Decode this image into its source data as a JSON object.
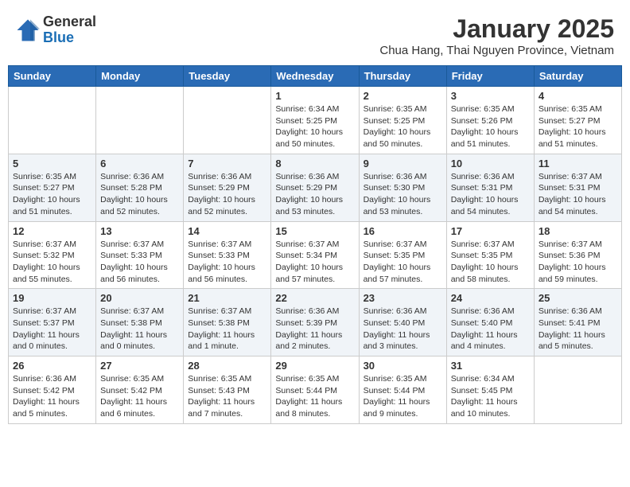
{
  "logo": {
    "general": "General",
    "blue": "Blue"
  },
  "title": "January 2025",
  "location": "Chua Hang, Thai Nguyen Province, Vietnam",
  "headers": [
    "Sunday",
    "Monday",
    "Tuesday",
    "Wednesday",
    "Thursday",
    "Friday",
    "Saturday"
  ],
  "weeks": [
    [
      {
        "day": "",
        "info": ""
      },
      {
        "day": "",
        "info": ""
      },
      {
        "day": "",
        "info": ""
      },
      {
        "day": "1",
        "info": "Sunrise: 6:34 AM\nSunset: 5:25 PM\nDaylight: 10 hours\nand 50 minutes."
      },
      {
        "day": "2",
        "info": "Sunrise: 6:35 AM\nSunset: 5:25 PM\nDaylight: 10 hours\nand 50 minutes."
      },
      {
        "day": "3",
        "info": "Sunrise: 6:35 AM\nSunset: 5:26 PM\nDaylight: 10 hours\nand 51 minutes."
      },
      {
        "day": "4",
        "info": "Sunrise: 6:35 AM\nSunset: 5:27 PM\nDaylight: 10 hours\nand 51 minutes."
      }
    ],
    [
      {
        "day": "5",
        "info": "Sunrise: 6:35 AM\nSunset: 5:27 PM\nDaylight: 10 hours\nand 51 minutes."
      },
      {
        "day": "6",
        "info": "Sunrise: 6:36 AM\nSunset: 5:28 PM\nDaylight: 10 hours\nand 52 minutes."
      },
      {
        "day": "7",
        "info": "Sunrise: 6:36 AM\nSunset: 5:29 PM\nDaylight: 10 hours\nand 52 minutes."
      },
      {
        "day": "8",
        "info": "Sunrise: 6:36 AM\nSunset: 5:29 PM\nDaylight: 10 hours\nand 53 minutes."
      },
      {
        "day": "9",
        "info": "Sunrise: 6:36 AM\nSunset: 5:30 PM\nDaylight: 10 hours\nand 53 minutes."
      },
      {
        "day": "10",
        "info": "Sunrise: 6:36 AM\nSunset: 5:31 PM\nDaylight: 10 hours\nand 54 minutes."
      },
      {
        "day": "11",
        "info": "Sunrise: 6:37 AM\nSunset: 5:31 PM\nDaylight: 10 hours\nand 54 minutes."
      }
    ],
    [
      {
        "day": "12",
        "info": "Sunrise: 6:37 AM\nSunset: 5:32 PM\nDaylight: 10 hours\nand 55 minutes."
      },
      {
        "day": "13",
        "info": "Sunrise: 6:37 AM\nSunset: 5:33 PM\nDaylight: 10 hours\nand 56 minutes."
      },
      {
        "day": "14",
        "info": "Sunrise: 6:37 AM\nSunset: 5:33 PM\nDaylight: 10 hours\nand 56 minutes."
      },
      {
        "day": "15",
        "info": "Sunrise: 6:37 AM\nSunset: 5:34 PM\nDaylight: 10 hours\nand 57 minutes."
      },
      {
        "day": "16",
        "info": "Sunrise: 6:37 AM\nSunset: 5:35 PM\nDaylight: 10 hours\nand 57 minutes."
      },
      {
        "day": "17",
        "info": "Sunrise: 6:37 AM\nSunset: 5:35 PM\nDaylight: 10 hours\nand 58 minutes."
      },
      {
        "day": "18",
        "info": "Sunrise: 6:37 AM\nSunset: 5:36 PM\nDaylight: 10 hours\nand 59 minutes."
      }
    ],
    [
      {
        "day": "19",
        "info": "Sunrise: 6:37 AM\nSunset: 5:37 PM\nDaylight: 11 hours\nand 0 minutes."
      },
      {
        "day": "20",
        "info": "Sunrise: 6:37 AM\nSunset: 5:38 PM\nDaylight: 11 hours\nand 0 minutes."
      },
      {
        "day": "21",
        "info": "Sunrise: 6:37 AM\nSunset: 5:38 PM\nDaylight: 11 hours\nand 1 minute."
      },
      {
        "day": "22",
        "info": "Sunrise: 6:36 AM\nSunset: 5:39 PM\nDaylight: 11 hours\nand 2 minutes."
      },
      {
        "day": "23",
        "info": "Sunrise: 6:36 AM\nSunset: 5:40 PM\nDaylight: 11 hours\nand 3 minutes."
      },
      {
        "day": "24",
        "info": "Sunrise: 6:36 AM\nSunset: 5:40 PM\nDaylight: 11 hours\nand 4 minutes."
      },
      {
        "day": "25",
        "info": "Sunrise: 6:36 AM\nSunset: 5:41 PM\nDaylight: 11 hours\nand 5 minutes."
      }
    ],
    [
      {
        "day": "26",
        "info": "Sunrise: 6:36 AM\nSunset: 5:42 PM\nDaylight: 11 hours\nand 5 minutes."
      },
      {
        "day": "27",
        "info": "Sunrise: 6:35 AM\nSunset: 5:42 PM\nDaylight: 11 hours\nand 6 minutes."
      },
      {
        "day": "28",
        "info": "Sunrise: 6:35 AM\nSunset: 5:43 PM\nDaylight: 11 hours\nand 7 minutes."
      },
      {
        "day": "29",
        "info": "Sunrise: 6:35 AM\nSunset: 5:44 PM\nDaylight: 11 hours\nand 8 minutes."
      },
      {
        "day": "30",
        "info": "Sunrise: 6:35 AM\nSunset: 5:44 PM\nDaylight: 11 hours\nand 9 minutes."
      },
      {
        "day": "31",
        "info": "Sunrise: 6:34 AM\nSunset: 5:45 PM\nDaylight: 11 hours\nand 10 minutes."
      },
      {
        "day": "",
        "info": ""
      }
    ]
  ]
}
